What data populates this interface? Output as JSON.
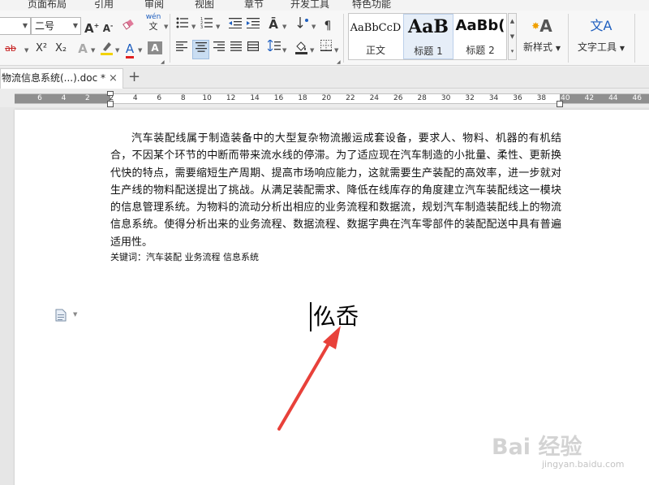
{
  "menu": {
    "tabs": [
      "页面布局",
      "引用",
      "审阅",
      "视图",
      "章节",
      "开发工具",
      "特色功能"
    ]
  },
  "ribbon": {
    "font_size_value": "二号",
    "font_grow": "A",
    "font_shrink": "A",
    "superscript": "X²",
    "subscript": "X₂",
    "strikethrough": "ab",
    "phonetic_top": "wén",
    "phonetic_bottom": "文",
    "style_gallery": [
      {
        "preview": "AaBbCcD",
        "label": "正文"
      },
      {
        "preview": "AaB",
        "label": "标题 1"
      },
      {
        "preview": "AaBb(",
        "label": "标题 2"
      }
    ],
    "new_style_label": "新样式",
    "text_tools_label": "文字工具",
    "text_tools_icon_letters": "文A"
  },
  "doc_tab": {
    "title": "物流信息系统(...).doc *",
    "close": "×",
    "add": "+"
  },
  "ruler": {
    "numbers": [
      "6",
      "4",
      "2",
      "2",
      "4",
      "6",
      "8",
      "10",
      "12",
      "14",
      "16",
      "18",
      "20",
      "22",
      "24",
      "26",
      "28",
      "30",
      "32",
      "34",
      "36",
      "38",
      "40",
      "42",
      "44",
      "46"
    ]
  },
  "document": {
    "abstract": "汽车装配线属于制造装备中的大型复杂物流搬运成套设备，要求人、物料、机器的有机结合，不因某个环节的中断而带来流水线的停滞。为了适应现在汽车制造的小批量、柔性、更新换代快的特点，需要缩短生产周期、提高市场响应能力，这就需要生产装配的高效率，进一步就对生产线的物料配送提出了挑战。从满足装配需求、降低在线库存的角度建立汽车装配线这一模块的信息管理系统。为物料的流动分析出相应的业务流程和数据流，规划汽车制造装配线上的物流信息系统。使得分析出来的业务流程、数据流程、数据字典在汽车零部件的装配配送中具有普遍适用性。",
    "keywords": "关键词：汽车装配   业务流程  信息系统",
    "heading_chars": "仫岙"
  },
  "watermark": {
    "main": "Bai 经验",
    "sub": "jingyan.baidu.com"
  },
  "colors": {
    "annotation_arrow": "#e8413a",
    "selected_button": "#c9ddf2",
    "accent_blue": "#1f5fbf",
    "highlight_yellow": "#f2d200",
    "font_color_red": "#e02020"
  }
}
